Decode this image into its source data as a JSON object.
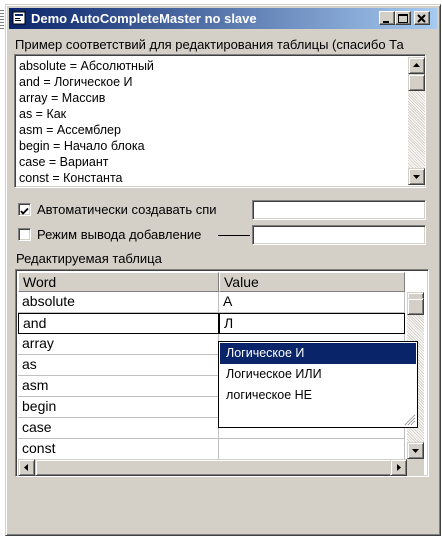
{
  "window": {
    "title": "Demo AutoCompleteMaster no slave",
    "minimize_symbol": "_",
    "maximize_symbol": "□",
    "close_symbol": "×"
  },
  "memo": {
    "caption": "Пример соответствий для редактирования таблицы (спасибо Та",
    "lines": [
      "absolute = Абсолютный",
      "and = Логическое И",
      "array = Массив",
      "as = Как",
      "asm = Ассемблер",
      "begin = Начало блока",
      "case = Вариант",
      "const = Константа"
    ]
  },
  "options": {
    "auto_create_label": "Автоматически создавать спи",
    "auto_create_checked": true,
    "append_mode_label": "Режим вывода добавление",
    "auto_create_value": "",
    "append_mode_value": ""
  },
  "grid": {
    "caption": "Редактируемая таблица",
    "columns": [
      "Word",
      "Value"
    ],
    "rows": [
      {
        "word": "absolute",
        "value": "А"
      },
      {
        "word": "and",
        "value": "Л"
      },
      {
        "word": "array",
        "value": ""
      },
      {
        "word": "as",
        "value": ""
      },
      {
        "word": "asm",
        "value": ""
      },
      {
        "word": "begin",
        "value": ""
      },
      {
        "word": "case",
        "value": ""
      },
      {
        "word": "const",
        "value": ""
      }
    ]
  },
  "autocomplete": {
    "items": [
      "Логическое И",
      "Логическое ИЛИ",
      "логическое НЕ"
    ],
    "selected_index": 0
  },
  "colors": {
    "face": "#d4d0c8",
    "title_start": "#0a246a",
    "title_end": "#a6caf0",
    "selection": "#0a246a"
  },
  "icons": [
    "app-icon",
    "minimize-icon",
    "maximize-icon",
    "close-icon",
    "check-icon",
    "arrow-up-icon",
    "arrow-down-icon",
    "arrow-left-icon",
    "arrow-right-icon",
    "size-grip-icon"
  ]
}
